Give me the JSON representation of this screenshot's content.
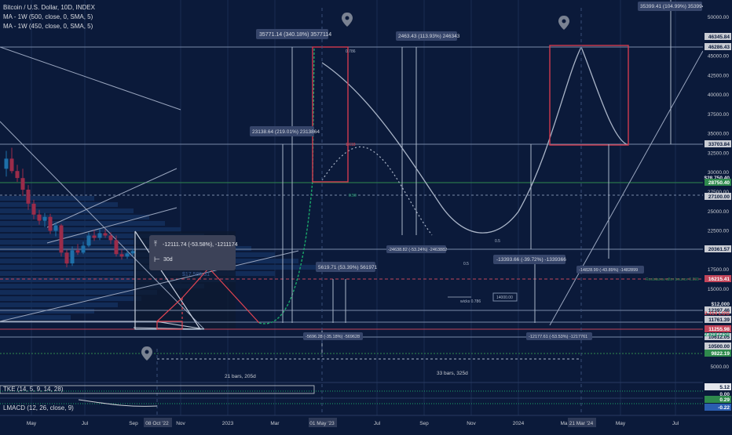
{
  "colors": {
    "background": "#0b1a3a",
    "grid": "#1c2e55",
    "text": "#c9ccd3",
    "bear_candle": "#9b2c4a",
    "bull_candle": "#1e6fa8",
    "box_red": "#d23a4e",
    "curve_green": "#1aa86a",
    "price_tag_green": "#2f8a4d"
  },
  "legend": [
    "Bitcoin / U.S. Dollar, 10D, INDEX",
    "MA - 1W (500, close, 0, SMA, 5)",
    "MA - 1W (450, close, 0, SMA, 5)"
  ],
  "price_axis": {
    "ticks": [
      "50000.00",
      "47500.00",
      "45000.00",
      "42500.00",
      "40000.00",
      "37500.00",
      "35000.00",
      "32500.00",
      "30000.00",
      "27500.00",
      "25000.00",
      "22500.00",
      "20000.00",
      "17500.00",
      "15000.00",
      "12500.00",
      "10000.00",
      "7500.00",
      "5000.00"
    ],
    "tags": [
      {
        "text": "46345.84",
        "style": "light"
      },
      {
        "text": "46286.43",
        "style": "light"
      },
      {
        "text": "33703.84",
        "style": "light"
      },
      {
        "text": "$28,750.40",
        "style": "plain"
      },
      {
        "text": "28750.40",
        "style": "green"
      },
      {
        "text": "27100.00",
        "style": "light"
      },
      {
        "text": "20361.57",
        "style": "light"
      },
      {
        "text": "16215.41",
        "style": "red"
      },
      {
        "text": "$12,000",
        "style": "plain"
      },
      {
        "text": "12397.46",
        "style": "light"
      },
      {
        "text": "2.414 LOG",
        "style": "redtext"
      },
      {
        "text": "11761.39",
        "style": "light"
      },
      {
        "text": "11255.98",
        "style": "red"
      },
      {
        "text": "10612.05",
        "style": "light"
      },
      {
        "text": "2.618 LOG",
        "style": "greentext"
      },
      {
        "text": "10500.00",
        "style": "light"
      },
      {
        "text": "9822.19",
        "style": "green"
      },
      {
        "text": "5.12",
        "style": "dark"
      },
      {
        "text": "0.00",
        "style": "plain"
      },
      {
        "text": "0.29",
        "style": "green"
      },
      {
        "text": "-0.22",
        "style": "blue"
      }
    ]
  },
  "time_axis": [
    "May",
    "Jul",
    "Sep",
    "08 Oct '22",
    "Nov",
    "2023",
    "Mar",
    "01 May '23",
    "Jul",
    "Sep",
    "Nov",
    "2024",
    "Ma",
    "21 Mar '24",
    "May",
    "Jul"
  ],
  "measures": {
    "m1": "35771.14 (340.18%) 3577114",
    "m2": "2463.43 (113.93%) 246343",
    "m3": "35399.41 (104.99%) 3539941",
    "m4": "23138.64 (219.01%) 2313864",
    "m5": "5619.71 (53.39%) 561971",
    "m6": "-24638.82 (-53.24%) -2463882",
    "m7": "-13393.66 (-39.72%) -1339366",
    "m8": "-14828.99 (-43.89%) -1482899",
    "m9": "-5696.28 (-35.18%) -569628",
    "m10": "-12177.61 (-53.53%) -1217761"
  },
  "fib": {
    "f786": "0.786",
    "f1618": "1.618",
    "f050": "0.50",
    "f05": "0.5",
    "f05b": "0.5",
    "wicks": "wicks 0.786",
    "val14000": "14000.00",
    "price17585": "$17,585.31",
    "resistance": "Resistance after bounce 0.236"
  },
  "tooltip": {
    "line1": "-12111.74 (-53.58%), -1211174",
    "line2": "30d"
  },
  "ranges": {
    "r1": "21 bars, 205d",
    "r2": "33 bars, 325d"
  },
  "indicators": {
    "tke": "TKE (14, 5, 9, 14, 28)",
    "lmacd": "LMACD (12, 26, close, 9)"
  },
  "candles": [
    [
      0,
      30500,
      32800,
      29500,
      31800
    ],
    [
      1,
      31800,
      33200,
      29900,
      30200
    ],
    [
      2,
      30200,
      31000,
      28800,
      29300
    ],
    [
      3,
      29300,
      30500,
      27000,
      27800
    ],
    [
      4,
      27800,
      28400,
      25200,
      26000
    ],
    [
      5,
      26000,
      26500,
      24000,
      24600
    ],
    [
      6,
      24600,
      25200,
      23300,
      23800
    ],
    [
      7,
      23800,
      24800,
      23000,
      24300
    ],
    [
      8,
      24300,
      24700,
      22100,
      22500
    ],
    [
      9,
      22500,
      23600,
      21800,
      23200
    ],
    [
      10,
      23200,
      23400,
      19200,
      19700
    ],
    [
      11,
      19700,
      20100,
      17800,
      18300
    ],
    [
      12,
      18300,
      20500,
      18000,
      20000
    ],
    [
      13,
      20000,
      20800,
      19400,
      19700
    ],
    [
      14,
      19700,
      21100,
      19500,
      20600
    ],
    [
      15,
      20600,
      22300,
      20400,
      21900
    ],
    [
      16,
      21900,
      22600,
      21200,
      21600
    ],
    [
      17,
      21600,
      22800,
      21300,
      22200
    ],
    [
      18,
      22200,
      22700,
      21600,
      21900
    ],
    [
      19,
      21900,
      22300,
      20800,
      21300
    ],
    [
      20,
      21300,
      21900,
      19200,
      19500
    ],
    [
      21,
      19500,
      20100,
      18800,
      19200
    ],
    [
      22,
      19200,
      19900,
      18900,
      19600
    ],
    [
      23,
      19600,
      20200,
      19300,
      19900
    ]
  ]
}
